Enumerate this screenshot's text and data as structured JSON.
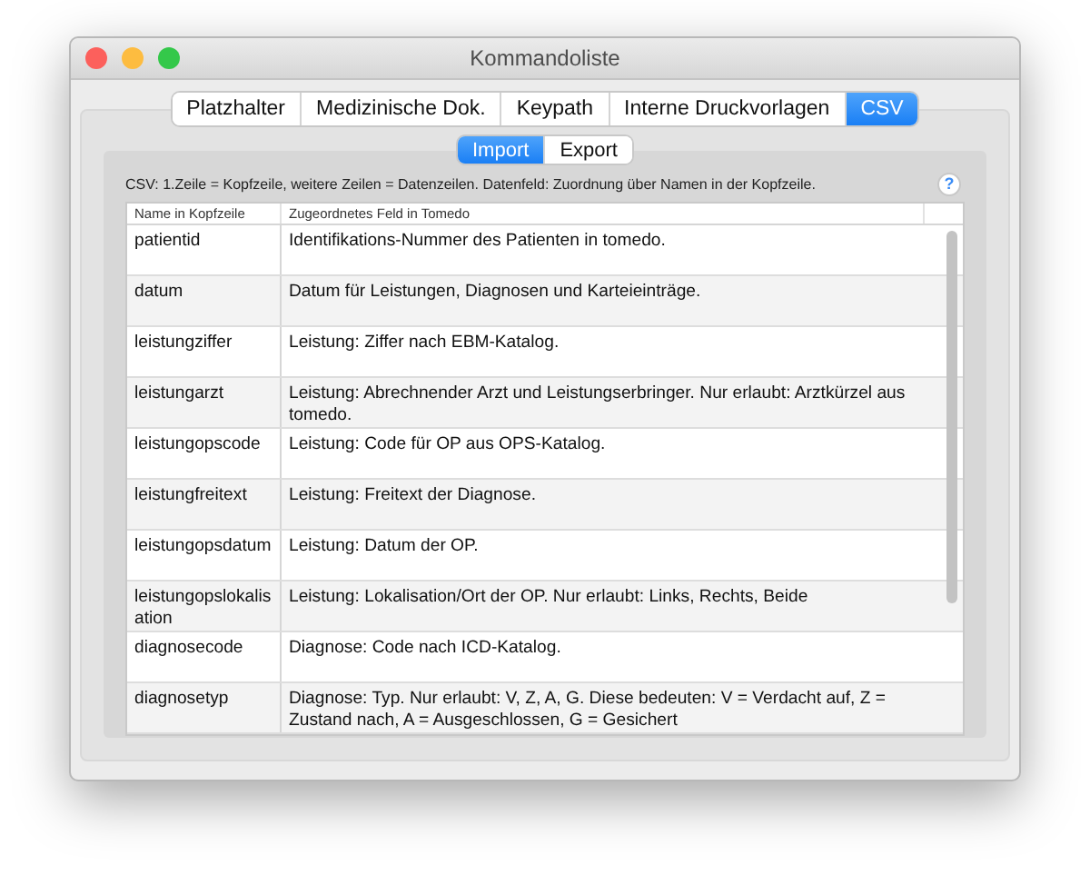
{
  "window": {
    "title": "Kommandoliste"
  },
  "tabs": [
    {
      "label": "Platzhalter",
      "selected": false
    },
    {
      "label": "Medizinische Dok.",
      "selected": false
    },
    {
      "label": "Keypath",
      "selected": false
    },
    {
      "label": "Interne Druckvorlagen",
      "selected": false
    },
    {
      "label": "CSV",
      "selected": true
    }
  ],
  "subtabs": [
    {
      "label": "Import",
      "selected": true
    },
    {
      "label": "Export",
      "selected": false
    }
  ],
  "description": "CSV: 1.Zeile = Kopfzeile, weitere Zeilen = Datenzeilen. Datenfeld: Zuordnung über Namen in der Kopfzeile.",
  "help_button": "?",
  "table": {
    "columns": [
      "Name in Kopfzeile",
      "Zugeordnetes Feld in Tomedo"
    ],
    "rows": [
      [
        "patientid",
        "Identifikations-Nummer des Patienten in tomedo."
      ],
      [
        "datum",
        "Datum für Leistungen, Diagnosen und Karteieinträge."
      ],
      [
        "leistungziffer",
        "Leistung: Ziffer nach EBM-Katalog."
      ],
      [
        "leistungarzt",
        "Leistung: Abrechnender Arzt und Leistungserbringer. Nur erlaubt: Arztkürzel aus tomedo."
      ],
      [
        "leistungopscode",
        "Leistung: Code für OP aus OPS-Katalog."
      ],
      [
        "leistungfreitext",
        "Leistung: Freitext der Diagnose."
      ],
      [
        "leistungopsdatum",
        "Leistung: Datum der OP."
      ],
      [
        "leistungopslokalisation",
        "Leistung: Lokalisation/Ort der OP. Nur erlaubt: Links, Rechts, Beide"
      ],
      [
        "diagnosecode",
        "Diagnose: Code nach ICD-Katalog."
      ],
      [
        "diagnosetyp",
        "Diagnose: Typ. Nur erlaubt: V, Z, A, G. Diese bedeuten: V = Verdacht auf, Z = Zustand nach, A = Ausgeschlossen, G = Gesichert"
      ]
    ]
  }
}
